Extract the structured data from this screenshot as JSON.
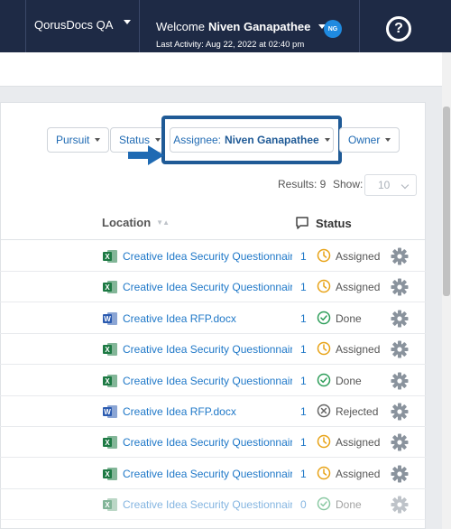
{
  "topbar": {
    "workspace": "QorusDocs QA",
    "welcome_prefix": "Welcome",
    "user_name": "Niven Ganapathee",
    "avatar_initials": "NG",
    "last_activity": "Last Activity: Aug 22, 2022 at 02:40 pm",
    "help_symbol": "?"
  },
  "filters": {
    "pursuit": "Pursuit",
    "status": "Status",
    "assignee_prefix": "Assignee:",
    "assignee_value": "Niven Ganapathee",
    "owner": "Owner"
  },
  "results": {
    "label": "Results: 9",
    "show_label": "Show:",
    "show_value": "10"
  },
  "table": {
    "col_location": "Location",
    "col_status": "Status",
    "rows": [
      {
        "type": "excel",
        "name": "Creative Idea Security Questionnaire.",
        "count": "1",
        "status": "Assigned",
        "status_kind": "assigned"
      },
      {
        "type": "excel",
        "name": "Creative Idea Security Questionnaire.",
        "count": "1",
        "status": "Assigned",
        "status_kind": "assigned"
      },
      {
        "type": "word",
        "name": "Creative Idea RFP.docx",
        "count": "1",
        "status": "Done",
        "status_kind": "done"
      },
      {
        "type": "excel",
        "name": "Creative Idea Security Questionnaire.",
        "count": "1",
        "status": "Assigned",
        "status_kind": "assigned"
      },
      {
        "type": "excel",
        "name": "Creative Idea Security Questionnaire.",
        "count": "1",
        "status": "Done",
        "status_kind": "done"
      },
      {
        "type": "word",
        "name": "Creative Idea RFP.docx",
        "count": "1",
        "status": "Rejected",
        "status_kind": "rejected"
      },
      {
        "type": "excel",
        "name": "Creative Idea Security Questionnaire.",
        "count": "1",
        "status": "Assigned",
        "status_kind": "assigned"
      },
      {
        "type": "excel",
        "name": "Creative Idea Security Questionnaire.",
        "count": "1",
        "status": "Assigned",
        "status_kind": "assigned"
      },
      {
        "type": "excel",
        "name": "Creative Idea Security Questionnaire.",
        "count": "0",
        "status": "Done",
        "status_kind": "done"
      }
    ]
  },
  "colors": {
    "nav_bg": "#1e2a45",
    "link_blue": "#1f78c8",
    "highlight_border": "#1f5a96",
    "assigned_orange": "#e8a317",
    "done_green": "#2e9e5a",
    "rejected_gray": "#666666",
    "excel_green": "#1d7a44",
    "word_blue": "#2b5bb0"
  }
}
